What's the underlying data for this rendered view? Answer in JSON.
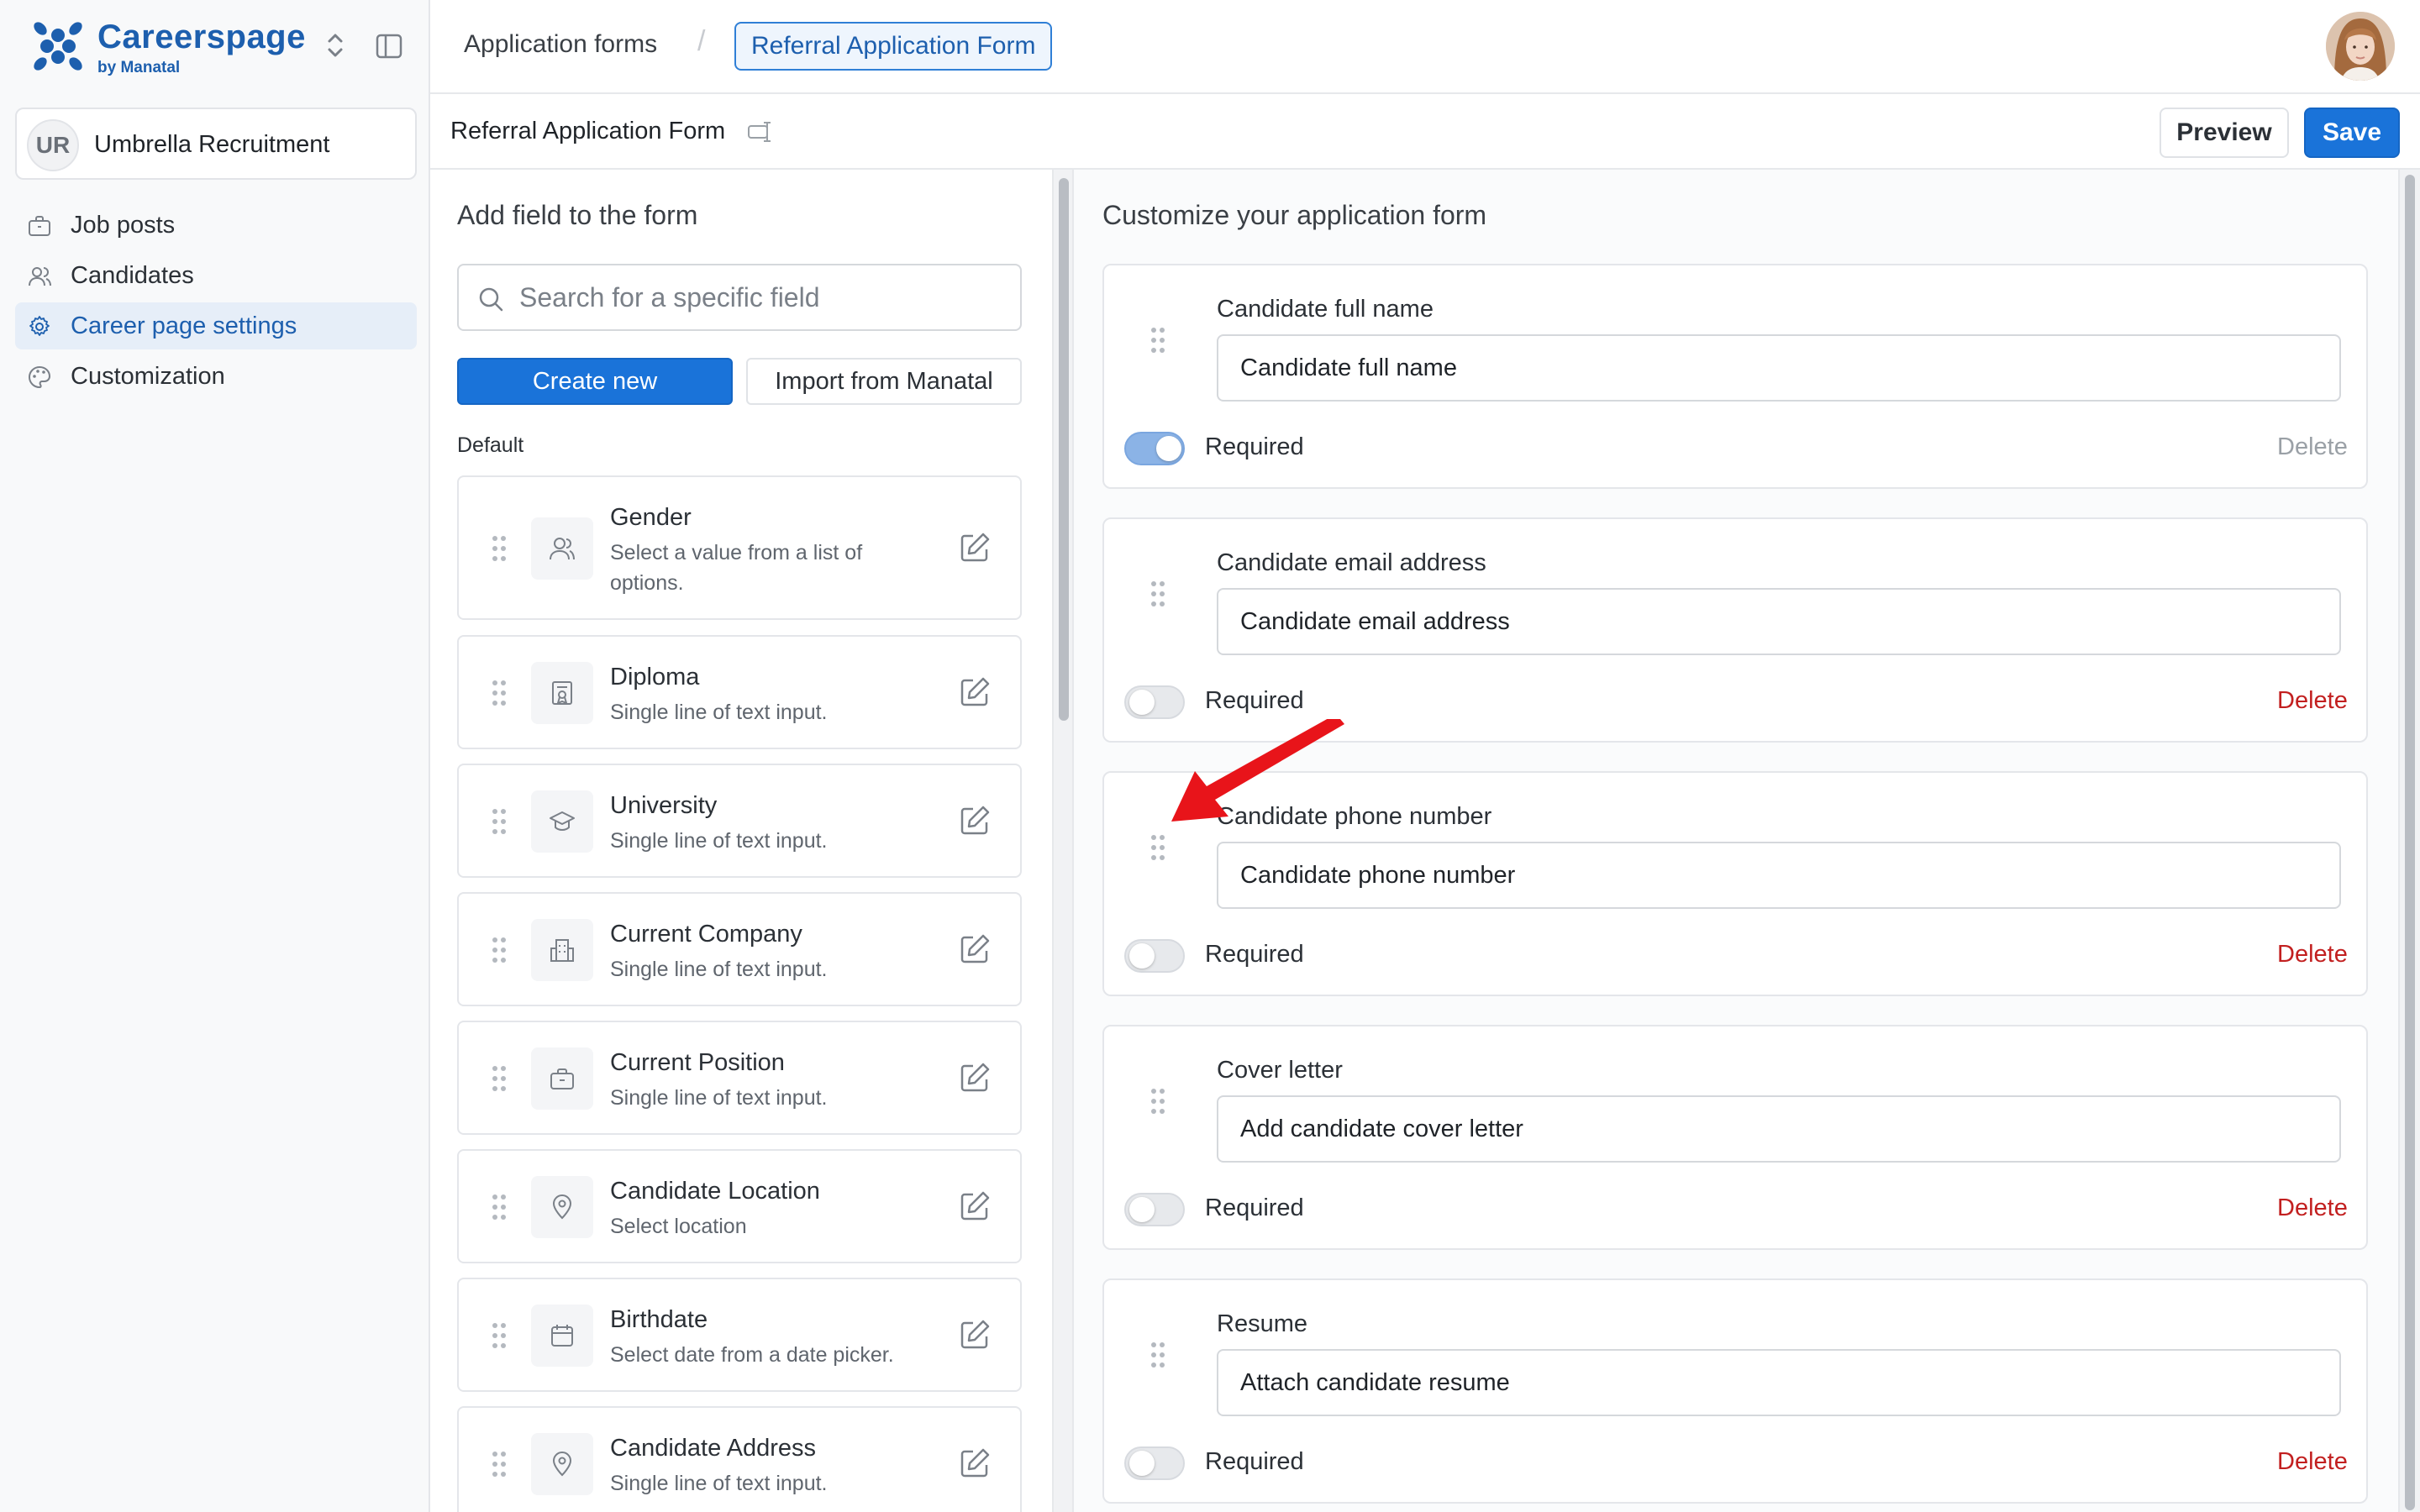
{
  "brand": {
    "name": "Careerspage",
    "sub": "by Manatal",
    "color": "#1d5fae"
  },
  "org": {
    "initials": "UR",
    "name": "Umbrella Recruitment"
  },
  "nav": {
    "items": [
      {
        "label": "Job posts",
        "icon": "briefcase-icon"
      },
      {
        "label": "Candidates",
        "icon": "users-icon"
      },
      {
        "label": "Career page settings",
        "icon": "gear-icon",
        "active": true
      },
      {
        "label": "Customization",
        "icon": "palette-icon"
      }
    ]
  },
  "breadcrumb": {
    "parent": "Application forms",
    "separator": "/",
    "current": "Referral Application Form"
  },
  "header": {
    "form_title": "Referral Application Form",
    "preview_label": "Preview",
    "save_label": "Save",
    "accent": "#1a73d9"
  },
  "left": {
    "title": "Add field to the form",
    "search_placeholder": "Search for a specific field",
    "create_label": "Create new",
    "import_label": "Import from Manatal",
    "section_label": "Default",
    "fields": [
      {
        "name": "Gender",
        "desc": "Select a value from a list of options.",
        "icon": "users-icon"
      },
      {
        "name": "Diploma",
        "desc": "Single line of text input.",
        "icon": "certificate-icon"
      },
      {
        "name": "University",
        "desc": "Single line of text input.",
        "icon": "graduation-cap-icon"
      },
      {
        "name": "Current Company",
        "desc": "Single line of text input.",
        "icon": "building-icon"
      },
      {
        "name": "Current Position",
        "desc": "Single line of text input.",
        "icon": "briefcase-icon"
      },
      {
        "name": "Candidate Location",
        "desc": "Select location",
        "icon": "map-pin-icon"
      },
      {
        "name": "Birthdate",
        "desc": "Select date from a date picker.",
        "icon": "calendar-icon"
      },
      {
        "name": "Candidate Address",
        "desc": "Single line of text input.",
        "icon": "map-pin-icon"
      }
    ]
  },
  "right": {
    "title": "Customize your application form",
    "required_label": "Required",
    "delete_label": "Delete",
    "delete_color": "#c21f1f",
    "questions": [
      {
        "label": "Candidate full name",
        "value": "Candidate full name",
        "required": true,
        "deletable": false
      },
      {
        "label": "Candidate email address",
        "value": "Candidate email address",
        "required": false,
        "deletable": true
      },
      {
        "label": "Candidate phone number",
        "value": "Candidate phone number",
        "required": false,
        "deletable": true
      },
      {
        "label": "Cover letter",
        "value": "Add candidate cover letter",
        "required": false,
        "deletable": true
      },
      {
        "label": "Resume",
        "value": "Attach candidate resume",
        "required": false,
        "deletable": true
      }
    ]
  },
  "annotation": {
    "arrow_color": "#e8141a"
  }
}
